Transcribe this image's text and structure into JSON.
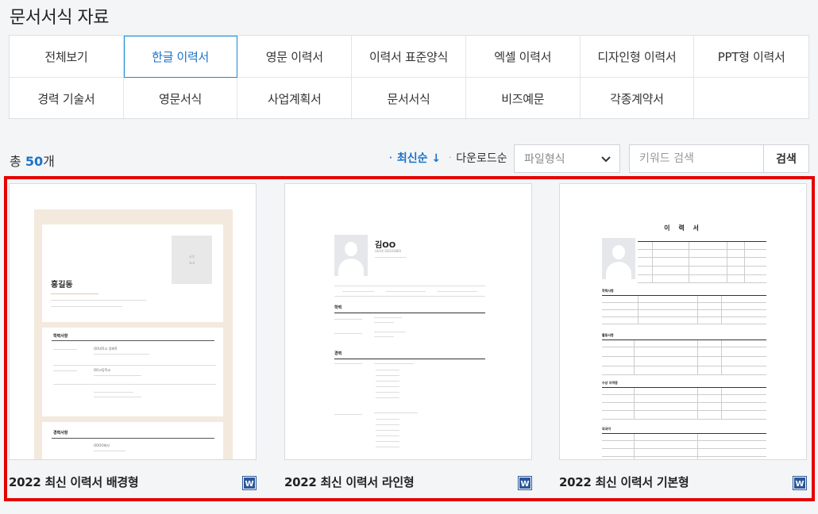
{
  "page_title": "문서서식 자료",
  "tabs": [
    {
      "label": "전체보기",
      "active": false
    },
    {
      "label": "한글 이력서",
      "active": true
    },
    {
      "label": "영문 이력서",
      "active": false
    },
    {
      "label": "이력서 표준양식",
      "active": false
    },
    {
      "label": "엑셀 이력서",
      "active": false
    },
    {
      "label": "디자인형 이력서",
      "active": false
    },
    {
      "label": "PPT형 이력서",
      "active": false
    },
    {
      "label": "경력 기술서",
      "active": false
    },
    {
      "label": "영문서식",
      "active": false
    },
    {
      "label": "사업계획서",
      "active": false
    },
    {
      "label": "문서서식",
      "active": false
    },
    {
      "label": "비즈예문",
      "active": false
    },
    {
      "label": "각종계약서",
      "active": false
    }
  ],
  "count": {
    "prefix": "총 ",
    "number": "50",
    "suffix": "개"
  },
  "sort": {
    "latest": "최신순 ↓",
    "downloads": "다운로드순"
  },
  "file_type_select": {
    "value": "파일형식"
  },
  "search": {
    "placeholder": "키워드 검색",
    "button": "검색"
  },
  "cards": [
    {
      "title": "2022 최신 이력서 배경형",
      "preview": {
        "name": "홍길동",
        "photo_label": "사진",
        "photo_size": "3x4",
        "section1": "학력사항",
        "school1": "OO대학교 경제학",
        "school2": "OO고등학교",
        "section2": "경력사항",
        "company": "OOOO회사"
      }
    },
    {
      "title": "2022 최신 이력서 라인형",
      "preview": {
        "name": "김OO",
        "role": "UI/UX DESIGNER",
        "section1": "학력",
        "section2": "경력"
      }
    },
    {
      "title": "2022 최신 이력서 기본형",
      "preview": {
        "doc_title": "이 력 서",
        "sections": [
          "학력사항",
          "활동사항",
          "수상 자격증",
          "외국어"
        ]
      }
    }
  ],
  "colors": {
    "accent": "#1a73c9",
    "highlight": "#e60000",
    "word_icon": "#2b579a"
  }
}
